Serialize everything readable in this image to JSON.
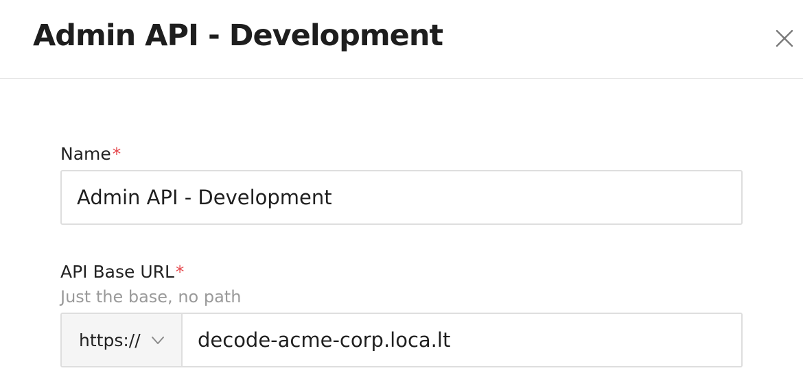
{
  "modal": {
    "title": "Admin API - Development",
    "close_icon": "close-icon"
  },
  "form": {
    "name_field": {
      "label": "Name",
      "required_marker": "*",
      "value": "Admin API - Development"
    },
    "api_base_url_field": {
      "label": "API Base URL",
      "required_marker": "*",
      "help_text": "Just the base, no path",
      "protocol": "https://",
      "protocol_icon": "chevron-down-icon",
      "value": "decode-acme-corp.loca.lt"
    }
  },
  "colors": {
    "required": "#e5484d",
    "border": "#dedede",
    "help_text": "#9a9a9a",
    "addon_background": "#f5f5f5"
  }
}
